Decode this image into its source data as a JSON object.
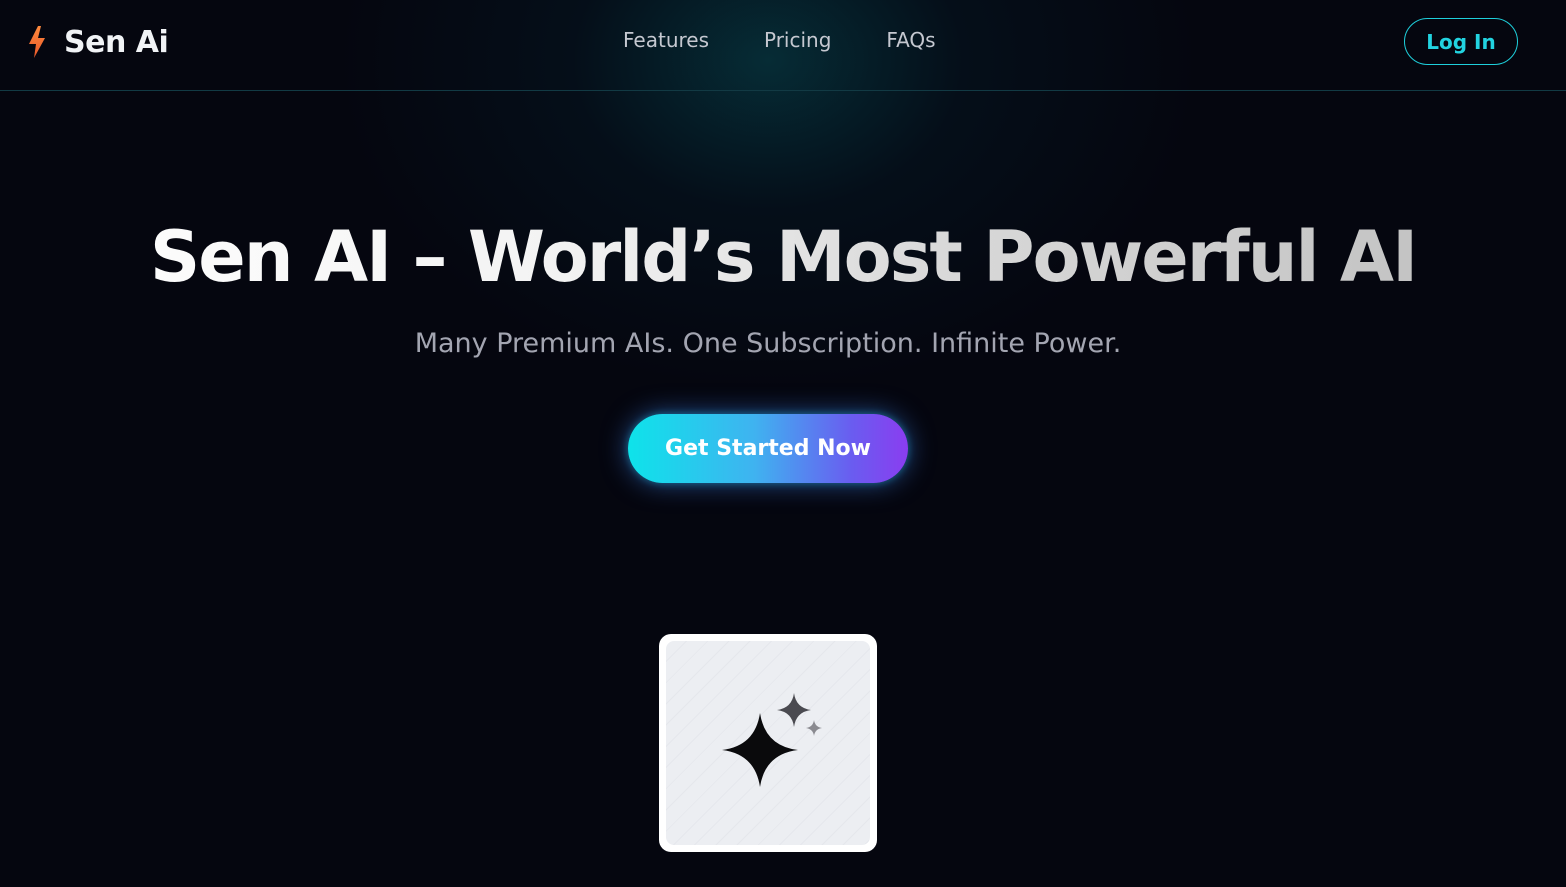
{
  "brand": {
    "name": "Sen Ai",
    "icon": "lightning-bolt-icon",
    "icon_color": "#f36b3b"
  },
  "nav": {
    "links": [
      "Features",
      "Pricing",
      "FAQs"
    ],
    "login_label": "Log In",
    "accent_color": "#22d3e0"
  },
  "hero": {
    "title": "Sen AI – World’s Most Powerful AI",
    "subtitle": "Many Premium AIs. One Subscription. Infinite Power.",
    "cta_label": "Get Started Now",
    "cta_gradient": [
      "#0ee3ea",
      "#8a3df0"
    ]
  },
  "preview": {
    "icon": "sparkles-icon"
  }
}
